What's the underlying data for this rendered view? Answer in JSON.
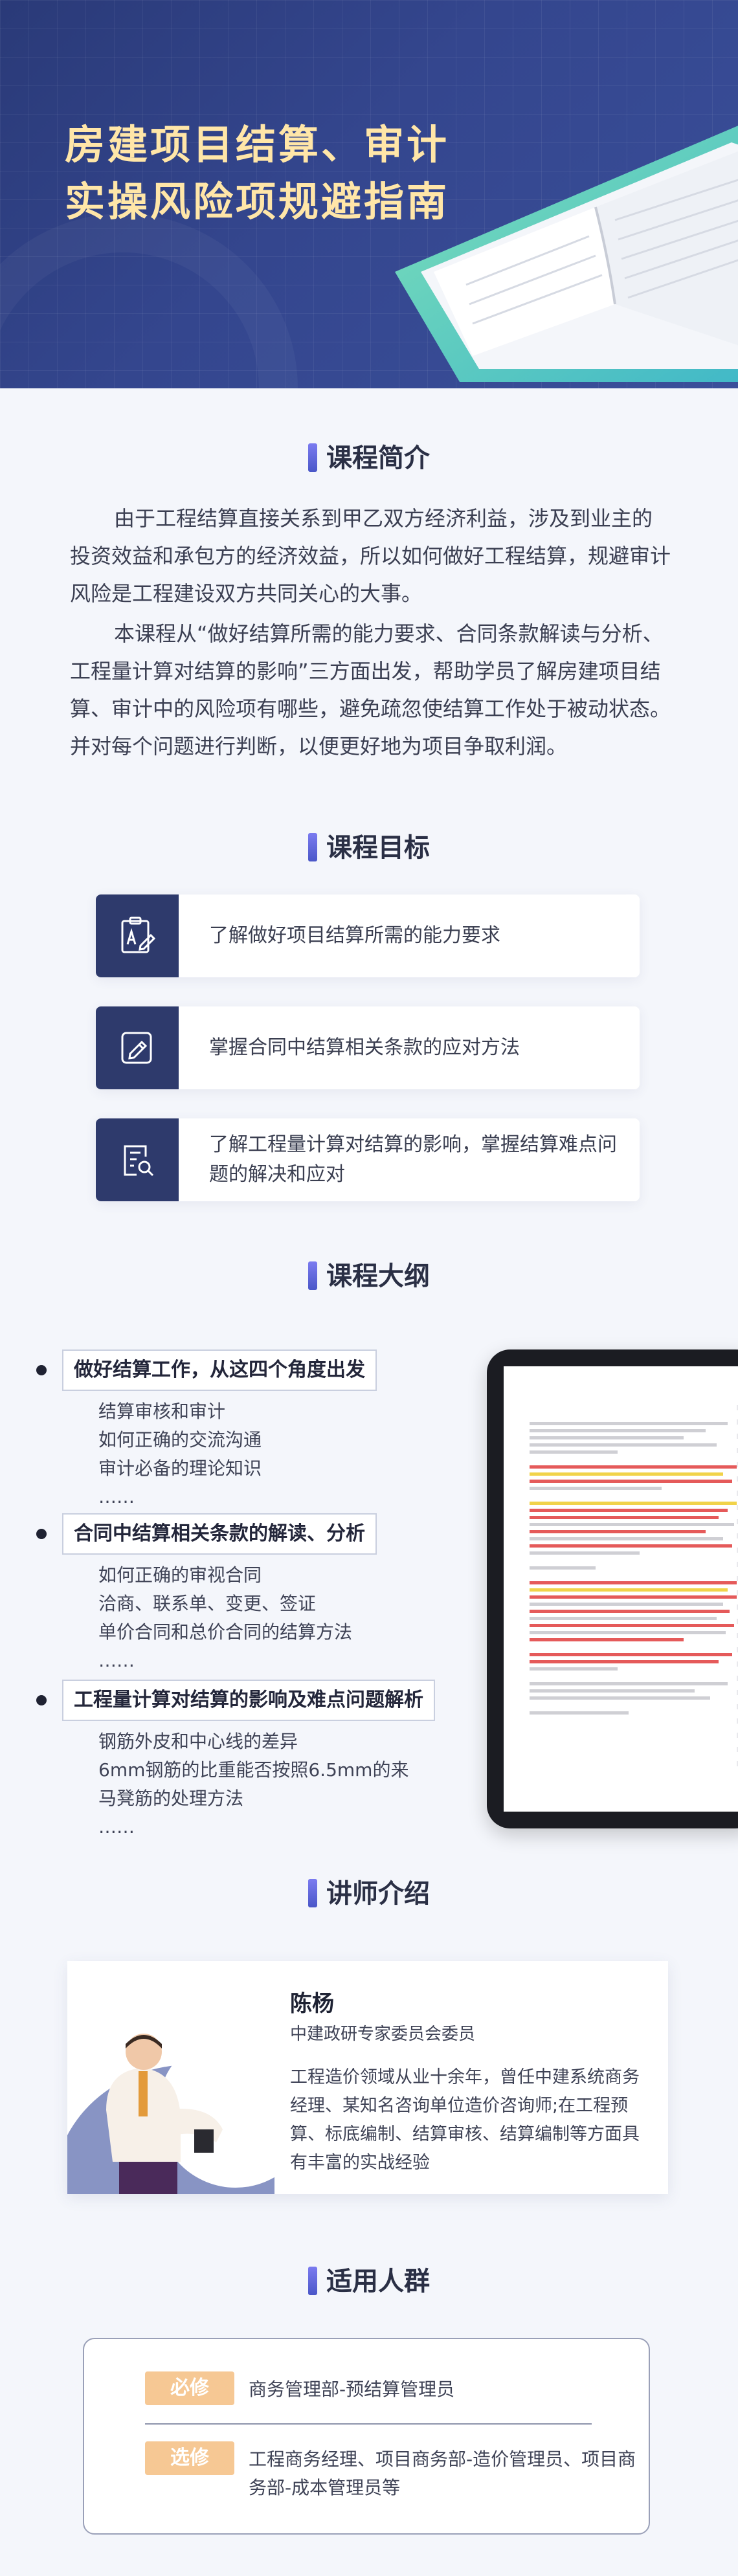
{
  "hero": {
    "title_line1": "房建项目结算、审计",
    "title_line2": "实操风险项规避指南"
  },
  "intro": {
    "heading": "课程简介",
    "paragraph1": "由于工程结算直接关系到甲乙双方经济利益，涉及到业主的投资效益和承包方的经济效益，所以如何做好工程结算，规避审计风险是工程建设双方共同关心的大事。",
    "paragraph2": "本课程从“做好结算所需的能力要求、合同条款解读与分析、工程量计算对结算的影响”三方面出发，帮助学员了解房建项目结算、审计中的风险项有哪些，避免疏忽使结算工作处于被动状态。并对每个问题进行判断，以便更好地为项目争取利润。"
  },
  "goals": {
    "heading": "课程目标",
    "items": [
      {
        "text": "了解做好项目结算所需的能力要求"
      },
      {
        "text": "掌握合同中结算相关条款的应对方法"
      },
      {
        "text": "了解工程量计算对结算的影响，掌握结算难点问题的解决和应对"
      }
    ]
  },
  "outline": {
    "heading": "课程大纲",
    "sections": [
      {
        "title": "做好结算工作，从这四个角度出发",
        "points": [
          "结算审核和审计",
          "如何正确的交流沟通",
          "审计必备的理论知识",
          "……"
        ]
      },
      {
        "title": "合同中结算相关条款的解读、分析",
        "points": [
          "如何正确的审视合同",
          "洽商、联系单、变更、签证",
          "单价合同和总价合同的结算方法",
          "……"
        ]
      },
      {
        "title": "工程量计算对结算的影响及难点问题解析",
        "points": [
          "钢筋外皮和中心线的差异",
          "6mm钢筋的比重能否按照6.5mm的来",
          "马凳筋的处理方法",
          "……"
        ]
      }
    ]
  },
  "teacher": {
    "heading": "讲师介绍",
    "name": "陈杨",
    "role": "中建政研专家委员会委员",
    "desc": "工程造价领域从业十余年，曾任中建系统商务经理、某知名咨询单位造价咨询师;在工程预算、标底编制、结算审核、结算编制等方面具有丰富的实战经验"
  },
  "audience": {
    "heading": "适用人群",
    "required_tag": "必修",
    "required_value": "商务管理部-预结算管理员",
    "elective_tag": "选修",
    "elective_value": "工程商务经理、项目商务部-造价管理员、项目商务部-成本管理员等"
  }
}
